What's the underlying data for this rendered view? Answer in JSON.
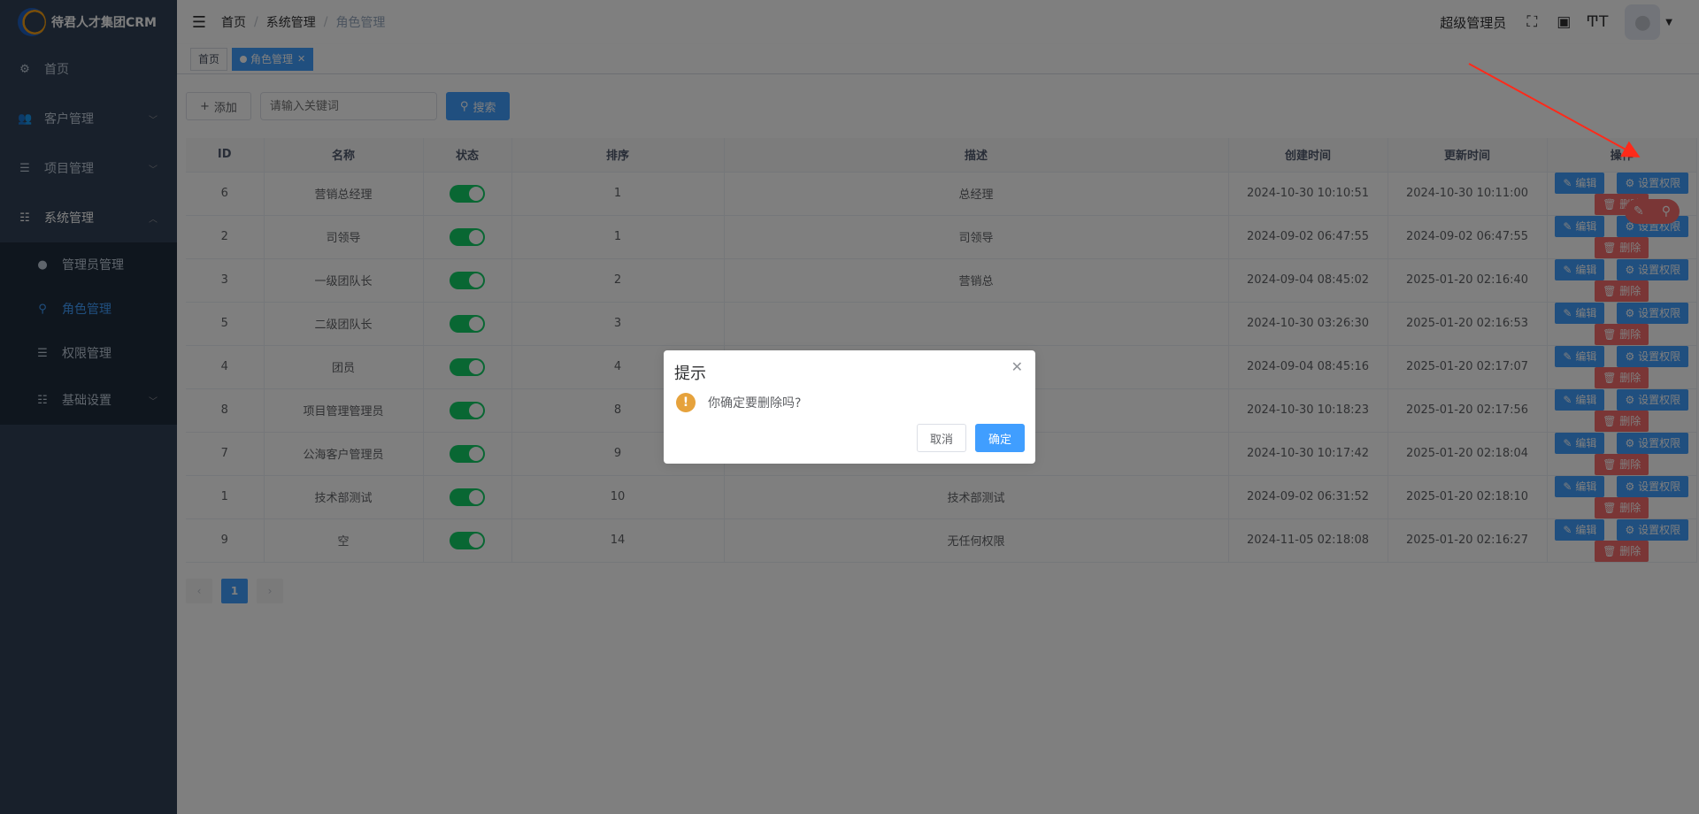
{
  "app": {
    "logo_text": "待君人才集团CRM"
  },
  "sidebar": {
    "items": [
      {
        "label": "首页",
        "icon": "dashboard-icon"
      },
      {
        "label": "客户管理",
        "icon": "users-icon"
      },
      {
        "label": "项目管理",
        "icon": "list-icon"
      },
      {
        "label": "系统管理",
        "icon": "sliders-icon"
      }
    ],
    "sub_items": [
      {
        "label": "管理员管理",
        "icon": "user-icon"
      },
      {
        "label": "角色管理",
        "icon": "tree-icon"
      },
      {
        "label": "权限管理",
        "icon": "checklist-icon"
      }
    ],
    "after_item": {
      "label": "基础设置",
      "icon": "sliders-icon"
    }
  },
  "header": {
    "breadcrumb": [
      "首页",
      "系统管理",
      "角色管理"
    ],
    "user_role": "超级管理员"
  },
  "tags": {
    "home": "首页",
    "active": "角色管理"
  },
  "toolbar": {
    "add_label": "添加",
    "search_placeholder": "请输入关键词",
    "search_label": "搜索"
  },
  "table": {
    "headers": [
      "ID",
      "名称",
      "状态",
      "排序",
      "描述",
      "创建时间",
      "更新时间",
      "操作"
    ],
    "rows": [
      {
        "id": "6",
        "name": "营销总经理",
        "sort": "1",
        "desc": "总经理",
        "created": "2024-10-30 10:10:51",
        "updated": "2024-10-30 10:11:00"
      },
      {
        "id": "2",
        "name": "司领导",
        "sort": "1",
        "desc": "司领导",
        "created": "2024-09-02 06:47:55",
        "updated": "2024-09-02 06:47:55"
      },
      {
        "id": "3",
        "name": "一级团队长",
        "sort": "2",
        "desc": "营销总",
        "created": "2024-09-04 08:45:02",
        "updated": "2025-01-20 02:16:40"
      },
      {
        "id": "5",
        "name": "二级团队长",
        "sort": "3",
        "desc": "",
        "created": "2024-10-30 03:26:30",
        "updated": "2025-01-20 02:16:53"
      },
      {
        "id": "4",
        "name": "团员",
        "sort": "4",
        "desc": "",
        "created": "2024-09-04 08:45:16",
        "updated": "2025-01-20 02:17:07"
      },
      {
        "id": "8",
        "name": "项目管理管理员",
        "sort": "8",
        "desc": "",
        "created": "2024-10-30 10:18:23",
        "updated": "2025-01-20 02:17:56"
      },
      {
        "id": "7",
        "name": "公海客户管理员",
        "sort": "9",
        "desc": "",
        "created": "2024-10-30 10:17:42",
        "updated": "2025-01-20 02:18:04"
      },
      {
        "id": "1",
        "name": "技术部测试",
        "sort": "10",
        "desc": "技术部测试",
        "created": "2024-09-02 06:31:52",
        "updated": "2025-01-20 02:18:10"
      },
      {
        "id": "9",
        "name": "空",
        "sort": "14",
        "desc": "无任何权限",
        "created": "2024-11-05 02:18:08",
        "updated": "2025-01-20 02:16:27"
      }
    ],
    "actions": {
      "edit": "编辑",
      "perm": "设置权限",
      "del": "删除"
    }
  },
  "pagination": {
    "current": "1"
  },
  "dialog": {
    "title": "提示",
    "message": "你确定要删除吗?",
    "cancel": "取消",
    "confirm": "确定"
  },
  "colors": {
    "primary": "#409eff",
    "danger": "#f56c6c",
    "success": "#13ce66",
    "sidebar": "#304156",
    "warning": "#e6a23c"
  }
}
